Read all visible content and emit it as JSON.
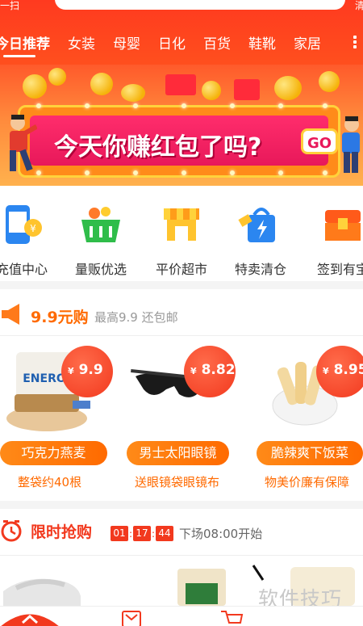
{
  "header": {
    "scan_label": "一扫",
    "clear_label": "清",
    "categories": [
      "今日推荐",
      "女装",
      "母婴",
      "日化",
      "百货",
      "鞋靴",
      "家居"
    ]
  },
  "banner": {
    "headline": "今天你赚红包了吗?",
    "go_label": "GO"
  },
  "quick_links": [
    {
      "label": "充值中心",
      "icon": "phone-recharge-icon"
    },
    {
      "label": "量贩优选",
      "icon": "basket-icon"
    },
    {
      "label": "平价超市",
      "icon": "store-icon"
    },
    {
      "label": "特卖清仓",
      "icon": "lightning-bag-icon"
    },
    {
      "label": "签到有宝",
      "icon": "treasure-chest-icon"
    }
  ],
  "section_99": {
    "title": "9.9元购",
    "subtitle": "最高9.9 还包邮",
    "products": [
      {
        "price_symbol": "¥",
        "price": "9.9",
        "name": "巧克力燕麦",
        "desc": "整袋约40根"
      },
      {
        "price_symbol": "¥",
        "price": "8.82",
        "name": "男士太阳眼镜",
        "desc": "送眼镜袋眼镜布"
      },
      {
        "price_symbol": "¥",
        "price": "8.95",
        "name": "脆辣爽下饭菜",
        "desc": "物美价廉有保障"
      }
    ]
  },
  "flash_sale": {
    "title": "限时抢购",
    "hours": "01",
    "minutes": "17",
    "seconds": "44",
    "next_session": "下场08:00开始"
  },
  "watermark": "软件技巧",
  "colors": {
    "brand_red": "#f2391e",
    "accent_orange": "#ff6a00"
  }
}
